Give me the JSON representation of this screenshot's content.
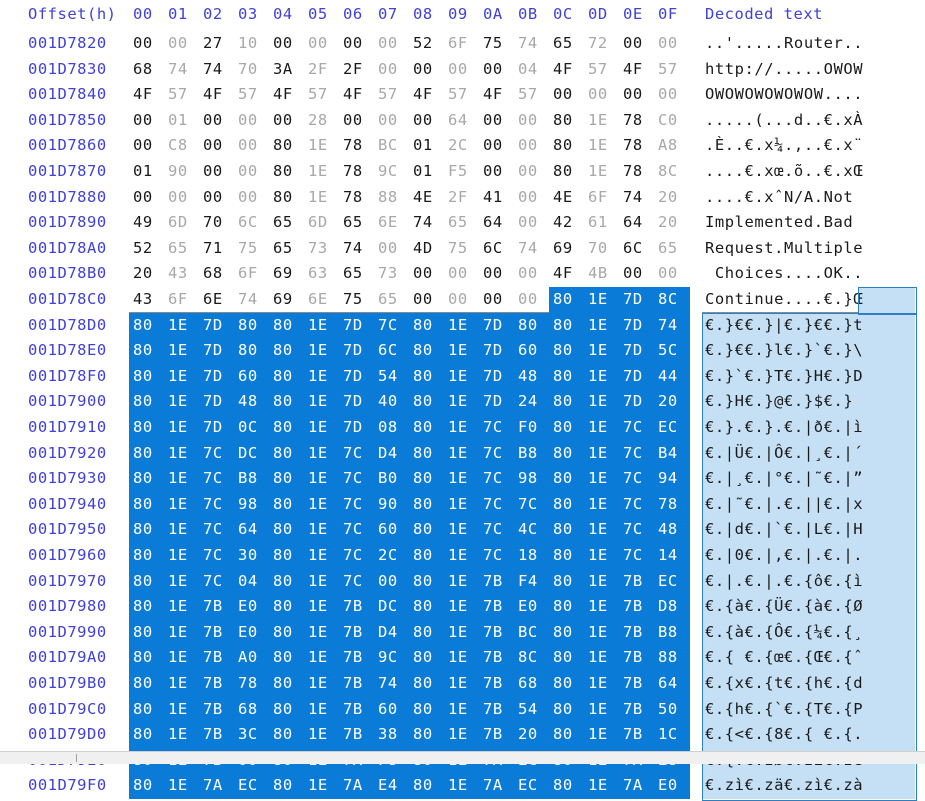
{
  "editor": {
    "title": "hex-editor-view",
    "offset_header": "Offset(h)",
    "decoded_header": "Decoded text",
    "column_headers": [
      "00",
      "01",
      "02",
      "03",
      "04",
      "05",
      "06",
      "07",
      "08",
      "09",
      "0A",
      "0B",
      "0C",
      "0D",
      "0E",
      "0F"
    ],
    "colors": {
      "offset_text": "#4141d8",
      "header_text": "#4141d8",
      "byte_even": "#1a1a1a",
      "byte_odd": "#a8a8a8",
      "decoded_text": "#1a1a1a",
      "selection_hex_bg": "#0a7cd8",
      "selection_hex_fg": "#ffffff",
      "selection_text_bg": "#c5e0f5",
      "selection_text_border": "#2d7fc4",
      "background": "#ffffff"
    },
    "selection": {
      "start_offset": "001D78C0",
      "start_column": "0C",
      "description": "selection begins at byte 0C of row 001D78C0 and continues to the end of the visible view"
    },
    "rows": [
      {
        "offset": "001D7820",
        "bytes": [
          "00",
          "00",
          "27",
          "10",
          "00",
          "00",
          "00",
          "00",
          "52",
          "6F",
          "75",
          "74",
          "65",
          "72",
          "00",
          "00"
        ],
        "decoded": "..'.....Router..",
        "sel_from": null
      },
      {
        "offset": "001D7830",
        "bytes": [
          "68",
          "74",
          "74",
          "70",
          "3A",
          "2F",
          "2F",
          "00",
          "00",
          "00",
          "00",
          "04",
          "4F",
          "57",
          "4F",
          "57"
        ],
        "decoded": "http://.....OWOW",
        "sel_from": null
      },
      {
        "offset": "001D7840",
        "bytes": [
          "4F",
          "57",
          "4F",
          "57",
          "4F",
          "57",
          "4F",
          "57",
          "4F",
          "57",
          "4F",
          "57",
          "00",
          "00",
          "00",
          "00"
        ],
        "decoded": "OWOWOWOWOWOW....",
        "sel_from": null
      },
      {
        "offset": "001D7850",
        "bytes": [
          "00",
          "01",
          "00",
          "00",
          "00",
          "28",
          "00",
          "00",
          "00",
          "64",
          "00",
          "00",
          "80",
          "1E",
          "78",
          "C0"
        ],
        "decoded": ".....(...d..€.xÀ",
        "sel_from": null
      },
      {
        "offset": "001D7860",
        "bytes": [
          "00",
          "C8",
          "00",
          "00",
          "80",
          "1E",
          "78",
          "BC",
          "01",
          "2C",
          "00",
          "00",
          "80",
          "1E",
          "78",
          "A8"
        ],
        "decoded": ".È..€.x¼.,..€.x¨",
        "sel_from": null
      },
      {
        "offset": "001D7870",
        "bytes": [
          "01",
          "90",
          "00",
          "00",
          "80",
          "1E",
          "78",
          "9C",
          "01",
          "F5",
          "00",
          "00",
          "80",
          "1E",
          "78",
          "8C"
        ],
        "decoded": "....€.xœ.õ..€.xŒ",
        "sel_from": null
      },
      {
        "offset": "001D7880",
        "bytes": [
          "00",
          "00",
          "00",
          "00",
          "80",
          "1E",
          "78",
          "88",
          "4E",
          "2F",
          "41",
          "00",
          "4E",
          "6F",
          "74",
          "20"
        ],
        "decoded": "....€.xˆN/A.Not ",
        "sel_from": null
      },
      {
        "offset": "001D7890",
        "bytes": [
          "49",
          "6D",
          "70",
          "6C",
          "65",
          "6D",
          "65",
          "6E",
          "74",
          "65",
          "64",
          "00",
          "42",
          "61",
          "64",
          "20"
        ],
        "decoded": "Implemented.Bad ",
        "sel_from": null
      },
      {
        "offset": "001D78A0",
        "bytes": [
          "52",
          "65",
          "71",
          "75",
          "65",
          "73",
          "74",
          "00",
          "4D",
          "75",
          "6C",
          "74",
          "69",
          "70",
          "6C",
          "65"
        ],
        "decoded": "Request.Multiple",
        "sel_from": null
      },
      {
        "offset": "001D78B0",
        "bytes": [
          "20",
          "43",
          "68",
          "6F",
          "69",
          "63",
          "65",
          "73",
          "00",
          "00",
          "00",
          "00",
          "4F",
          "4B",
          "00",
          "00"
        ],
        "decoded": " Choices....OK..",
        "sel_from": null
      },
      {
        "offset": "001D78C0",
        "bytes": [
          "43",
          "6F",
          "6E",
          "74",
          "69",
          "6E",
          "75",
          "65",
          "00",
          "00",
          "00",
          "00",
          "80",
          "1E",
          "7D",
          "8C"
        ],
        "decoded": "Continue....€.}Œ",
        "sel_from": 12
      },
      {
        "offset": "001D78D0",
        "bytes": [
          "80",
          "1E",
          "7D",
          "80",
          "80",
          "1E",
          "7D",
          "7C",
          "80",
          "1E",
          "7D",
          "80",
          "80",
          "1E",
          "7D",
          "74"
        ],
        "decoded": "€.}€€.}|€.}€€.}t",
        "sel_from": 0
      },
      {
        "offset": "001D78E0",
        "bytes": [
          "80",
          "1E",
          "7D",
          "80",
          "80",
          "1E",
          "7D",
          "6C",
          "80",
          "1E",
          "7D",
          "60",
          "80",
          "1E",
          "7D",
          "5C"
        ],
        "decoded": "€.}€€.}l€.}`€.}\\",
        "sel_from": 0
      },
      {
        "offset": "001D78F0",
        "bytes": [
          "80",
          "1E",
          "7D",
          "60",
          "80",
          "1E",
          "7D",
          "54",
          "80",
          "1E",
          "7D",
          "48",
          "80",
          "1E",
          "7D",
          "44"
        ],
        "decoded": "€.}`€.}T€.}H€.}D",
        "sel_from": 0
      },
      {
        "offset": "001D7900",
        "bytes": [
          "80",
          "1E",
          "7D",
          "48",
          "80",
          "1E",
          "7D",
          "40",
          "80",
          "1E",
          "7D",
          "24",
          "80",
          "1E",
          "7D",
          "20"
        ],
        "decoded": "€.}H€.}@€.}$€.} ",
        "sel_from": 0
      },
      {
        "offset": "001D7910",
        "bytes": [
          "80",
          "1E",
          "7D",
          "0C",
          "80",
          "1E",
          "7D",
          "08",
          "80",
          "1E",
          "7C",
          "F0",
          "80",
          "1E",
          "7C",
          "EC"
        ],
        "decoded": "€.}.€.}.€.|ð€.|ì",
        "sel_from": 0
      },
      {
        "offset": "001D7920",
        "bytes": [
          "80",
          "1E",
          "7C",
          "DC",
          "80",
          "1E",
          "7C",
          "D4",
          "80",
          "1E",
          "7C",
          "B8",
          "80",
          "1E",
          "7C",
          "B4"
        ],
        "decoded": "€.|Ü€.|Ô€.|¸€.|´",
        "sel_from": 0
      },
      {
        "offset": "001D7930",
        "bytes": [
          "80",
          "1E",
          "7C",
          "B8",
          "80",
          "1E",
          "7C",
          "B0",
          "80",
          "1E",
          "7C",
          "98",
          "80",
          "1E",
          "7C",
          "94"
        ],
        "decoded": "€.|¸€.|°€.|˜€.|”",
        "sel_from": 0
      },
      {
        "offset": "001D7940",
        "bytes": [
          "80",
          "1E",
          "7C",
          "98",
          "80",
          "1E",
          "7C",
          "90",
          "80",
          "1E",
          "7C",
          "7C",
          "80",
          "1E",
          "7C",
          "78"
        ],
        "decoded": "€.|˜€.|.€.||€.|x",
        "sel_from": 0
      },
      {
        "offset": "001D7950",
        "bytes": [
          "80",
          "1E",
          "7C",
          "64",
          "80",
          "1E",
          "7C",
          "60",
          "80",
          "1E",
          "7C",
          "4C",
          "80",
          "1E",
          "7C",
          "48"
        ],
        "decoded": "€.|d€.|`€.|L€.|H",
        "sel_from": 0
      },
      {
        "offset": "001D7960",
        "bytes": [
          "80",
          "1E",
          "7C",
          "30",
          "80",
          "1E",
          "7C",
          "2C",
          "80",
          "1E",
          "7C",
          "18",
          "80",
          "1E",
          "7C",
          "14"
        ],
        "decoded": "€.|0€.|,€.|.€.|.",
        "sel_from": 0
      },
      {
        "offset": "001D7970",
        "bytes": [
          "80",
          "1E",
          "7C",
          "04",
          "80",
          "1E",
          "7C",
          "00",
          "80",
          "1E",
          "7B",
          "F4",
          "80",
          "1E",
          "7B",
          "EC"
        ],
        "decoded": "€.|.€.|.€.{ô€.{ì",
        "sel_from": 0
      },
      {
        "offset": "001D7980",
        "bytes": [
          "80",
          "1E",
          "7B",
          "E0",
          "80",
          "1E",
          "7B",
          "DC",
          "80",
          "1E",
          "7B",
          "E0",
          "80",
          "1E",
          "7B",
          "D8"
        ],
        "decoded": "€.{à€.{Ü€.{à€.{Ø",
        "sel_from": 0
      },
      {
        "offset": "001D7990",
        "bytes": [
          "80",
          "1E",
          "7B",
          "E0",
          "80",
          "1E",
          "7B",
          "D4",
          "80",
          "1E",
          "7B",
          "BC",
          "80",
          "1E",
          "7B",
          "B8"
        ],
        "decoded": "€.{à€.{Ô€.{¼€.{¸",
        "sel_from": 0
      },
      {
        "offset": "001D79A0",
        "bytes": [
          "80",
          "1E",
          "7B",
          "A0",
          "80",
          "1E",
          "7B",
          "9C",
          "80",
          "1E",
          "7B",
          "8C",
          "80",
          "1E",
          "7B",
          "88"
        ],
        "decoded": "€.{ €.{œ€.{Œ€.{ˆ",
        "sel_from": 0
      },
      {
        "offset": "001D79B0",
        "bytes": [
          "80",
          "1E",
          "7B",
          "78",
          "80",
          "1E",
          "7B",
          "74",
          "80",
          "1E",
          "7B",
          "68",
          "80",
          "1E",
          "7B",
          "64"
        ],
        "decoded": "€.{x€.{t€.{h€.{d",
        "sel_from": 0
      },
      {
        "offset": "001D79C0",
        "bytes": [
          "80",
          "1E",
          "7B",
          "68",
          "80",
          "1E",
          "7B",
          "60",
          "80",
          "1E",
          "7B",
          "54",
          "80",
          "1E",
          "7B",
          "50"
        ],
        "decoded": "€.{h€.{`€.{T€.{P",
        "sel_from": 0
      },
      {
        "offset": "001D79D0",
        "bytes": [
          "80",
          "1E",
          "7B",
          "3C",
          "80",
          "1E",
          "7B",
          "38",
          "80",
          "1E",
          "7B",
          "20",
          "80",
          "1E",
          "7B",
          "1C"
        ],
        "decoded": "€.{<€.{8€.{ €.{.",
        "sel_from": 0
      },
      {
        "offset": "001D79E0",
        "bytes": [
          "80",
          "1E",
          "7B",
          "00",
          "80",
          "1E",
          "7A",
          "F8",
          "80",
          "1E",
          "7A",
          "EC",
          "80",
          "1E",
          "7A",
          "E8"
        ],
        "decoded": "€.{.€.zø€.zì€.zè",
        "sel_from": 0
      },
      {
        "offset": "001D79F0",
        "bytes": [
          "80",
          "1E",
          "7A",
          "EC",
          "80",
          "1E",
          "7A",
          "E4",
          "80",
          "1E",
          "7A",
          "EC",
          "80",
          "1E",
          "7A",
          "E0"
        ],
        "decoded": "€.zì€.zä€.zì€.zà",
        "sel_from": 0
      }
    ]
  }
}
